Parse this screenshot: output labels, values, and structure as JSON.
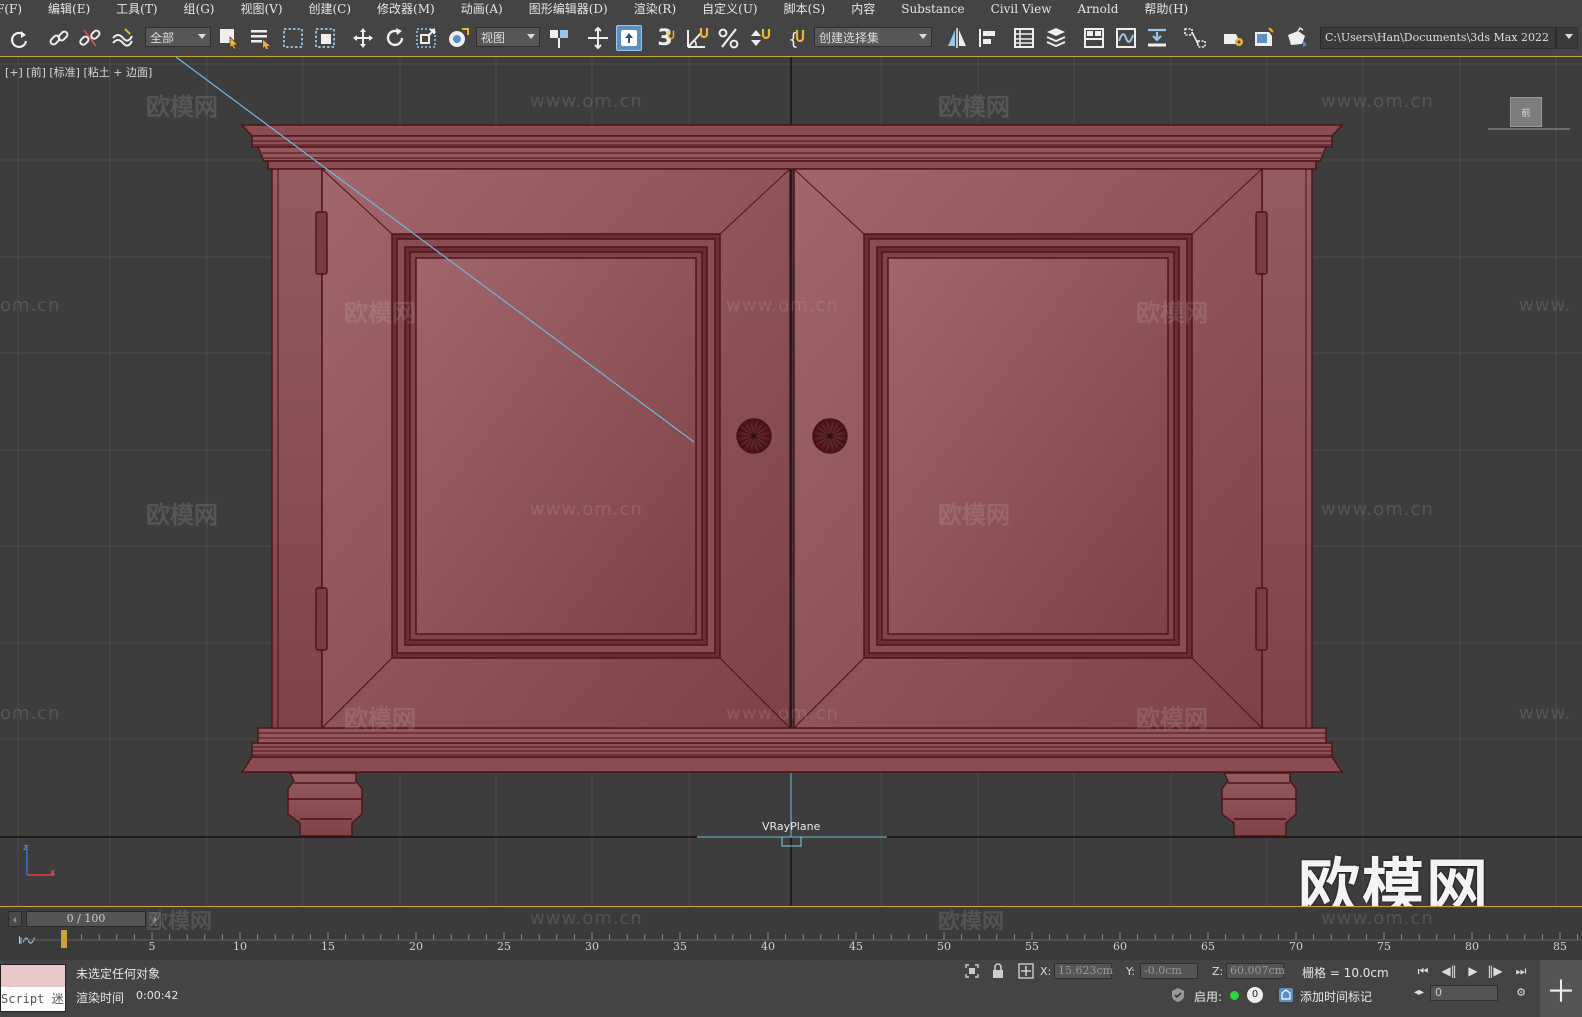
{
  "menu": [
    "F(F)",
    "编辑(E)",
    "工具(T)",
    "组(G)",
    "视图(V)",
    "创建(C)",
    "修改器(M)",
    "动画(A)",
    "图形编辑器(D)",
    "渲染(R)",
    "自定义(U)",
    "脚本(S)",
    "内容",
    "Substance",
    "Civil View",
    "Arnold",
    "帮助(H)"
  ],
  "toolbar": {
    "selection_filter": "全部",
    "ref_coord": "视图",
    "named_selection": "创建选择集",
    "project_path": "C:\\Users\\Han\\Documents\\3ds Max 2022",
    "snap_label": "3",
    "icons": [
      "redo-icon",
      "link-icon",
      "unlink-icon",
      "bind-spacewarp-icon",
      "select-object-icon",
      "select-by-name-icon",
      "rect-selection-icon",
      "window-crossing-icon",
      "move-icon",
      "rotate-icon",
      "scale-icon",
      "place-icon",
      "select-manipulate-icon",
      "pivot-icon",
      "snap-toggle-icon",
      "angle-snap-icon",
      "percent-snap-icon",
      "spinner-snap-icon",
      "edit-named-sets-icon",
      "mirror-icon",
      "align-icon",
      "scene-explorer-icon",
      "layer-explorer-icon",
      "toggle-ribbon-icon",
      "curve-editor-icon",
      "dope-sheet-icon",
      "schematic-view-icon",
      "render-setup-icon",
      "rendered-frame-icon",
      "render-icon"
    ]
  },
  "viewport": {
    "label": "[+] [前] [标准] [粘土 + 边面]",
    "object_label": "VRayPlane",
    "watermark_cn": "欧模网",
    "watermark_url": "www.om.cn",
    "watermark_url_partial": "om.cn",
    "watermark_url_cut": "www.",
    "logo": "欧模网",
    "viewcube": "前"
  },
  "timeline": {
    "position": "0 / 100",
    "ticks": [
      "5",
      "10",
      "15",
      "20",
      "25",
      "30",
      "35",
      "40",
      "45",
      "50",
      "55",
      "60",
      "65",
      "70",
      "75",
      "80",
      "85"
    ],
    "current_frame": 0
  },
  "status": {
    "maxscript": "Script 迷",
    "selection": "未选定任何对象",
    "render_time_label": "渲染时间",
    "render_time": "0:00:42",
    "x_label": "X:",
    "x_value": "15.623cm",
    "y_label": "Y:",
    "y_value": "-0.0cm",
    "z_label": "Z:",
    "z_value": "60.007cm",
    "grid": "栅格 = 10.0cm",
    "enable_label": "启用:",
    "enable_count": "0",
    "add_time_tag": "添加时间标记",
    "frame_value": "0"
  },
  "colors": {
    "cabinet": "#8e4f52",
    "cabinet_dark": "#5a1f22",
    "accent": "#c7a33a",
    "selection_blue": "#5c8fbf"
  }
}
